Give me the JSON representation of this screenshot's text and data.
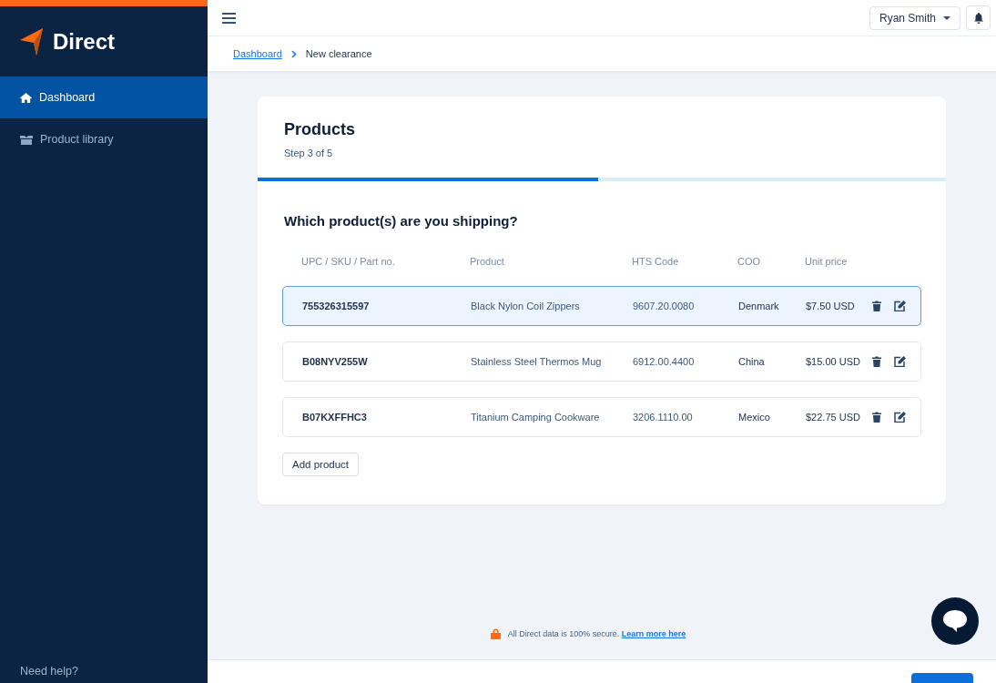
{
  "sidebar": {
    "logo": "Direct",
    "items": [
      {
        "label": "Dashboard",
        "selected": true
      },
      {
        "label": "Product library",
        "selected": false
      }
    ],
    "help": "Need help?"
  },
  "topbar": {
    "user": "Ryan Smith"
  },
  "breadcrumb": [
    {
      "label": "Dashboard",
      "kind": "link"
    },
    {
      "label": "New clearance",
      "kind": "current"
    }
  ],
  "card": {
    "title": "Products",
    "step": "Step 3 of 5",
    "progress": {
      "level": 0.495
    },
    "question": "Which product(s) are you shipping?",
    "columns": [
      "UPC / SKU / Part no.",
      "Product",
      "HTS Code",
      "COO",
      "Unit price"
    ],
    "rows": [
      {
        "sku": "755326315597",
        "product": "Black Nylon Coil Zippers",
        "hts": "9607.20.0080",
        "coo": "Denmark",
        "price": "$7.50 USD",
        "selected": true
      },
      {
        "sku": "B08NYV255W",
        "product": "Stainless Steel Thermos Mug",
        "hts": "6912.00.4400",
        "coo": "China",
        "price": "$15.00 USD",
        "selected": false
      },
      {
        "sku": "B07KXFFHC3",
        "product": "Titanium Camping Cookware",
        "hts": "3206.1110.00",
        "coo": "Mexico",
        "price": "$22.75 USD",
        "selected": false
      }
    ],
    "add_button": "Add product"
  },
  "security": {
    "text": "All Direct data is 100% secure.",
    "link": "Learn more here"
  }
}
